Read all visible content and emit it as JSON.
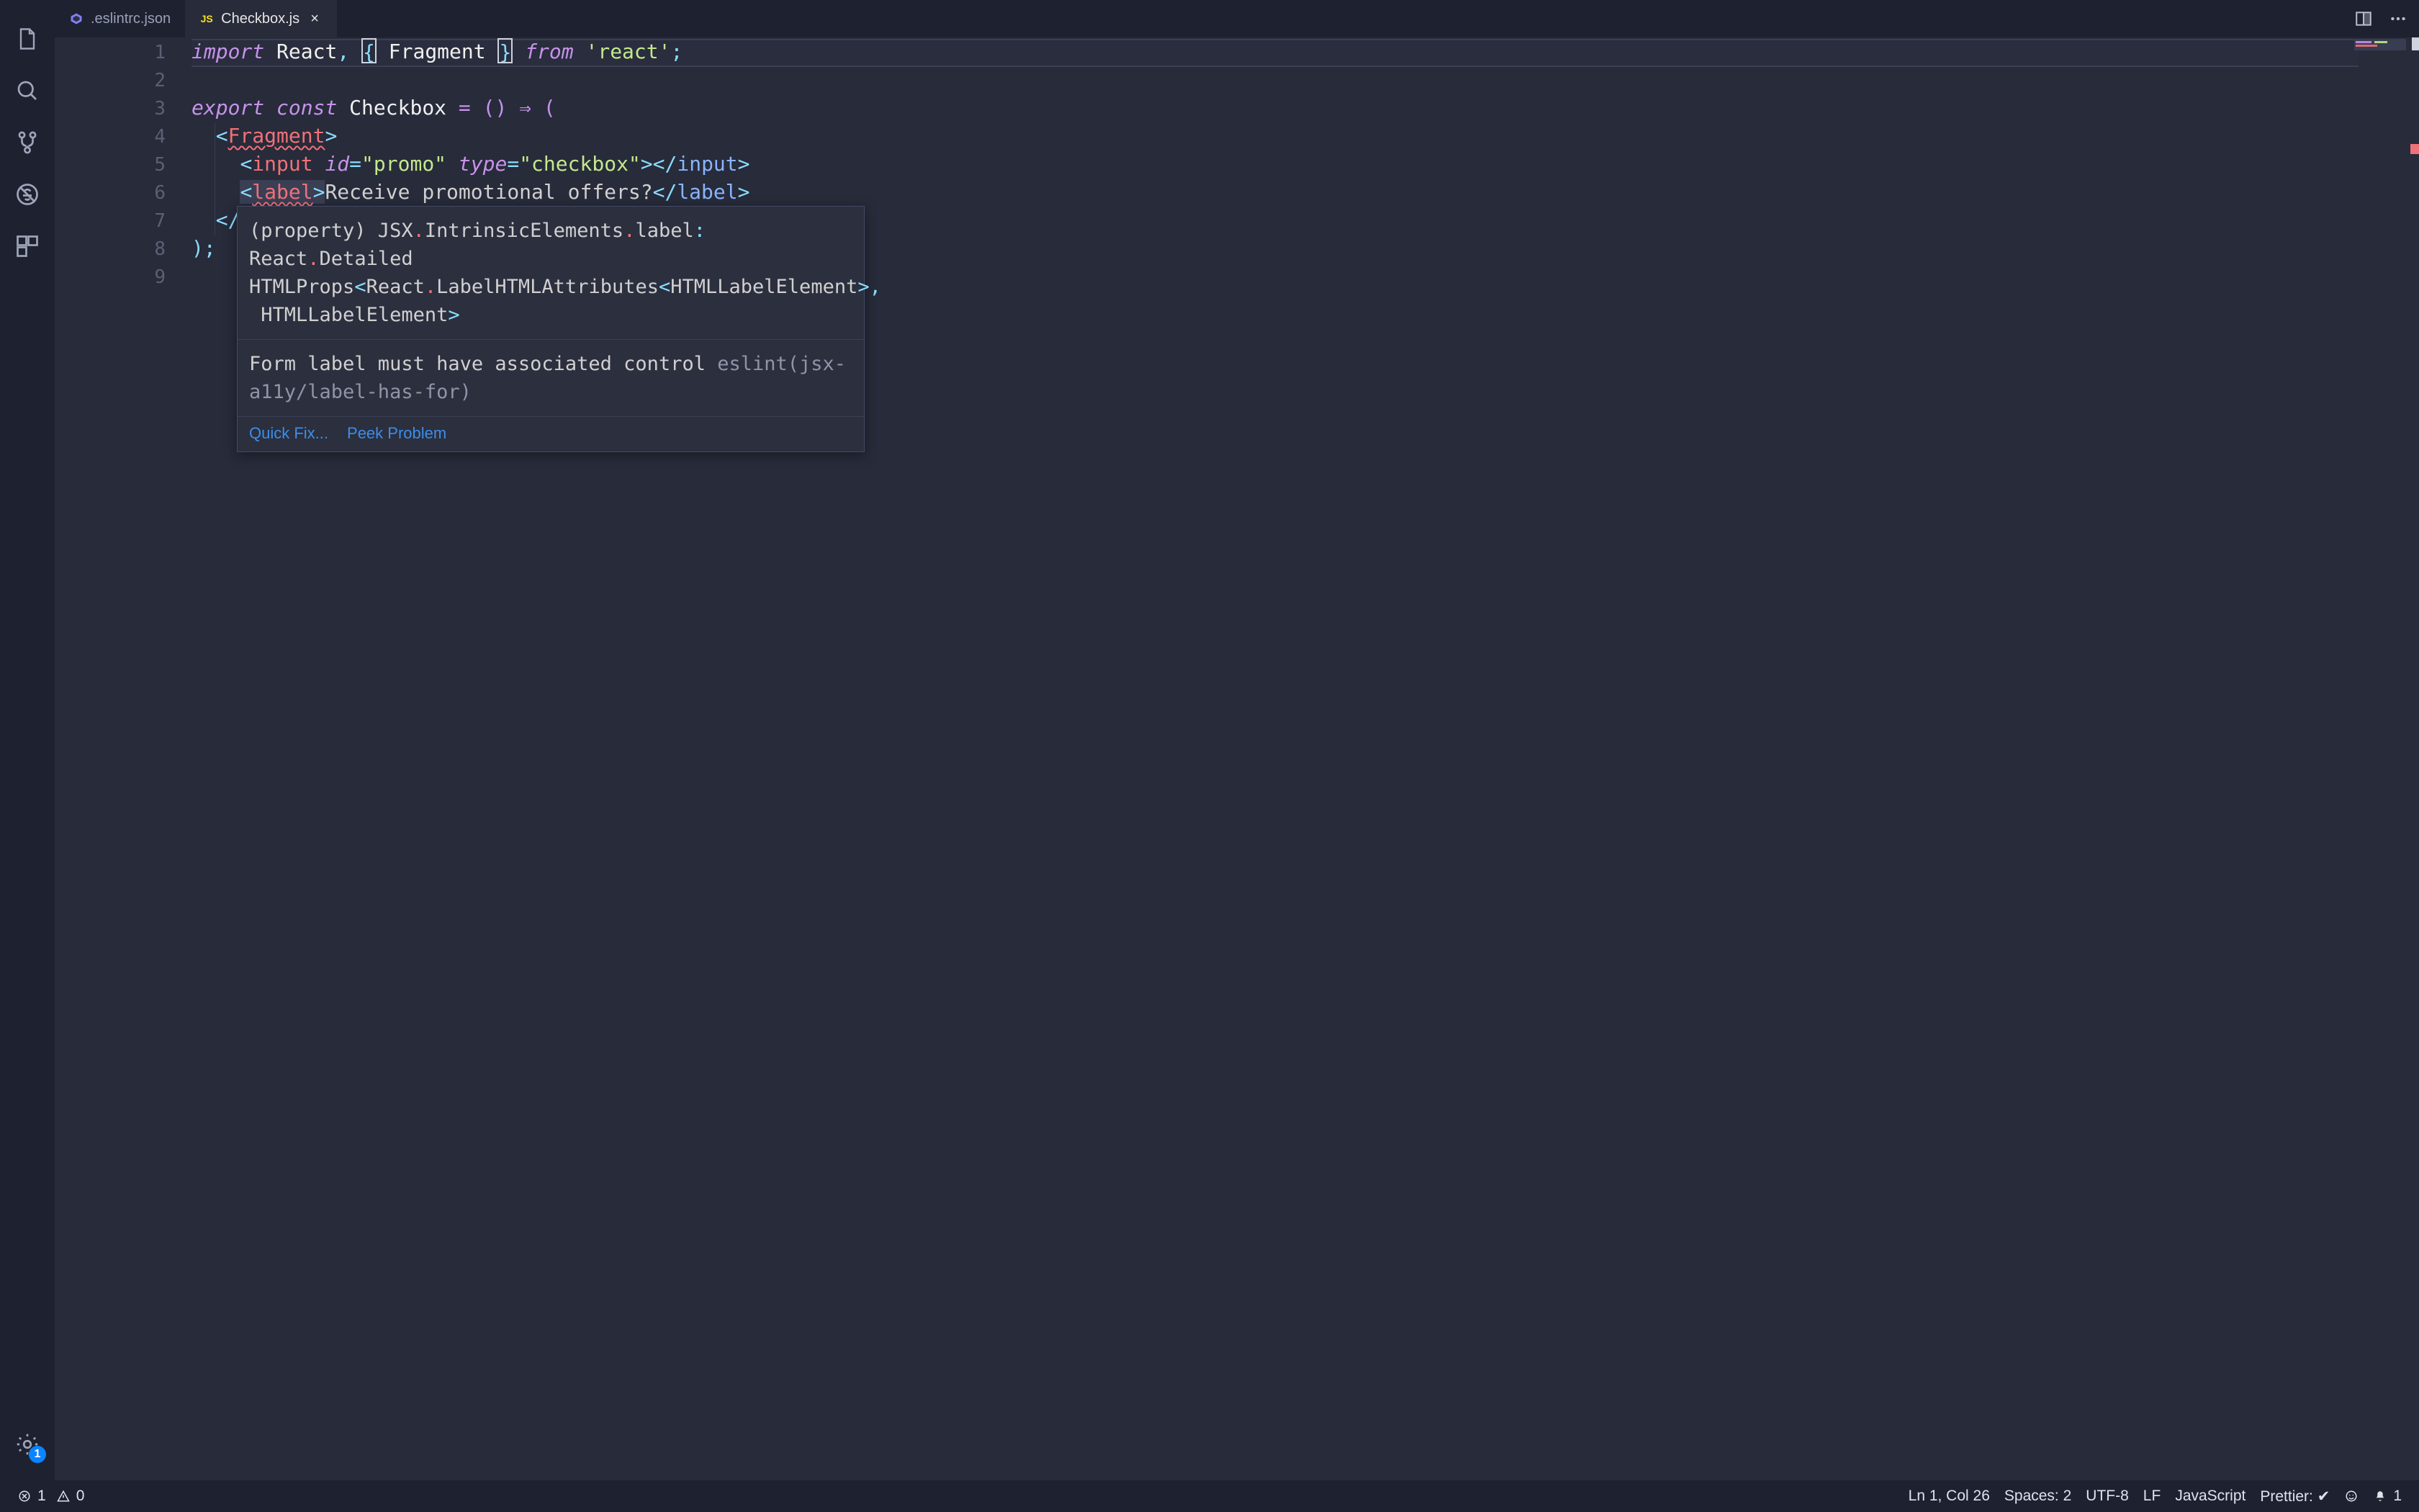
{
  "tabs": [
    {
      "label": ".eslintrc.json",
      "active": false,
      "icon": "eslint"
    },
    {
      "label": "Checkbox.js",
      "active": true,
      "icon": "js",
      "icon_text": "JS",
      "close": "×"
    }
  ],
  "gutter": [
    "1",
    "2",
    "3",
    "4",
    "5",
    "6",
    "7",
    "8",
    "9"
  ],
  "code": {
    "l1_import": "import",
    "l1_react": "React",
    "l1_comma": ",",
    "l1_lbrace": "{",
    "l1_fragment": "Fragment",
    "l1_rbrace": "}",
    "l1_from": "from",
    "l1_str": "'react'",
    "l1_semi": ";",
    "l3_export": "export",
    "l3_const": "const",
    "l3_name": "Checkbox",
    "l3_eq_arrow_paren": " = () ⇒ (",
    "l4_open": "<",
    "l4_frag": "Fragment",
    "l4_close": ">",
    "l5_open": "<",
    "l5_input": "input",
    "l5_id_attr": "id",
    "l5_eq1": "=",
    "l5_id_val": "\"promo\"",
    "l5_type_attr": "type",
    "l5_eq2": "=",
    "l5_type_val": "\"checkbox\"",
    "l5_closebr": ">",
    "l5_clopen": "</",
    "l5_input2": "input",
    "l5_close2": ">",
    "l6_open": "<",
    "l6_label": "label",
    "l6_close": ">",
    "l6_text": "Receive promotional offers?",
    "l6_clopen": "</",
    "l6_label2": "label",
    "l6_close2": ">",
    "l7_clopen": "</",
    "l8_paren_semi": ");"
  },
  "hover": {
    "sec1_html": "(property) JSX<span class='hk-dot'>.</span>IntrinsicElements<span class='hk-dot'>.</span>label<span class='hk-pu'>:</span> React<span class='hk-dot'>.</span>Detailed\nHTMLProps<span class='hk-pu'>&lt;</span>React<span class='hk-dot'>.</span>LabelHTMLAttributes<span class='hk-pu'>&lt;</span>HTMLLabelElement<span class='hk-pu'>&gt;</span><span class='hk-pu'>,</span>\n HTMLLabelElement<span class='hk-pu'>&gt;</span>",
    "sec2_msg": "Form label must have associated control ",
    "sec2_src": "eslint(jsx-a11y/label-has-for)",
    "link_quickfix": "Quick Fix...",
    "link_peek": "Peek Problem"
  },
  "activity": {
    "gear_badge": "1"
  },
  "status": {
    "errors": "1",
    "warnings": "0",
    "ln_col": "Ln 1, Col 26",
    "spaces": "Spaces: 2",
    "encoding": "UTF-8",
    "eol": "LF",
    "language": "JavaScript",
    "prettier": "Prettier: ✔",
    "bell": "1"
  }
}
